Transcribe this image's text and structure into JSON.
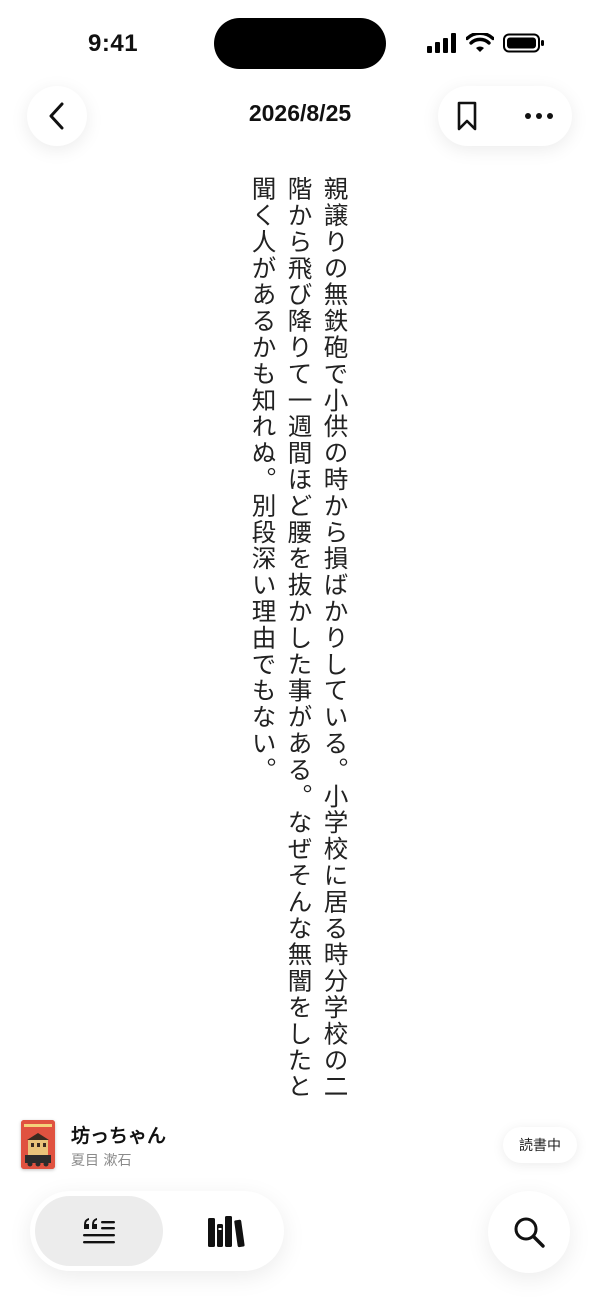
{
  "status_bar": {
    "time": "9:41"
  },
  "header": {
    "title": "2026/8/25"
  },
  "content": {
    "text": "親譲りの無鉄砲で小供の時から損ばかりしている。小学校に居る時分学校の二階から飛び降りて一週間ほど腰を抜かした事がある。なぜそんな無闇をしたと聞く人があるかも知れぬ。別段深い理由でもない。"
  },
  "book": {
    "title": "坊っちゃん",
    "author": "夏目 漱石",
    "status": "読書中",
    "cover_color": "#d94a3a"
  },
  "icons": {
    "back": "chevron-left-icon",
    "bookmark": "bookmark-icon",
    "more": "more-horizontal-icon",
    "quote_list": "quote-list-icon",
    "library": "books-icon",
    "search": "search-icon"
  }
}
